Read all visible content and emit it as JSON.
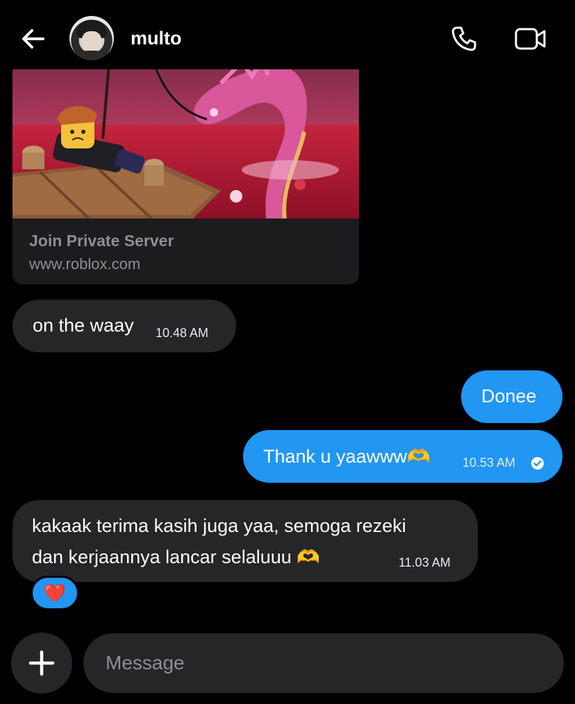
{
  "header": {
    "contact_name": "multo",
    "back_icon": "arrow-left-icon",
    "call_icon": "phone-icon",
    "video_icon": "video-camera-icon"
  },
  "shared_post": {
    "title": "Join Private Server",
    "url": "www.roblox.com"
  },
  "messages": [
    {
      "direction": "incoming",
      "text": "on the waay",
      "time": "10.48 AM"
    },
    {
      "direction": "outgoing",
      "text": "Donee",
      "time": ""
    },
    {
      "direction": "outgoing",
      "text": "Thank u yaawww🫶",
      "time": "10.53 AM",
      "status": "read-check-icon"
    },
    {
      "direction": "incoming",
      "line1": "kakaak terima kasih juga yaa, semoga rezeki",
      "line2": "dan kerjaannya lancar selaluuu 🫶",
      "time": "11.03 AM",
      "reaction": "❤️"
    }
  ],
  "composer": {
    "placeholder": "Message",
    "add_icon": "plus-icon"
  },
  "colors": {
    "background": "#000000",
    "incoming_bubble": "#262628",
    "outgoing_bubble": "#2196f3",
    "muted_text": "#8e8e93"
  }
}
